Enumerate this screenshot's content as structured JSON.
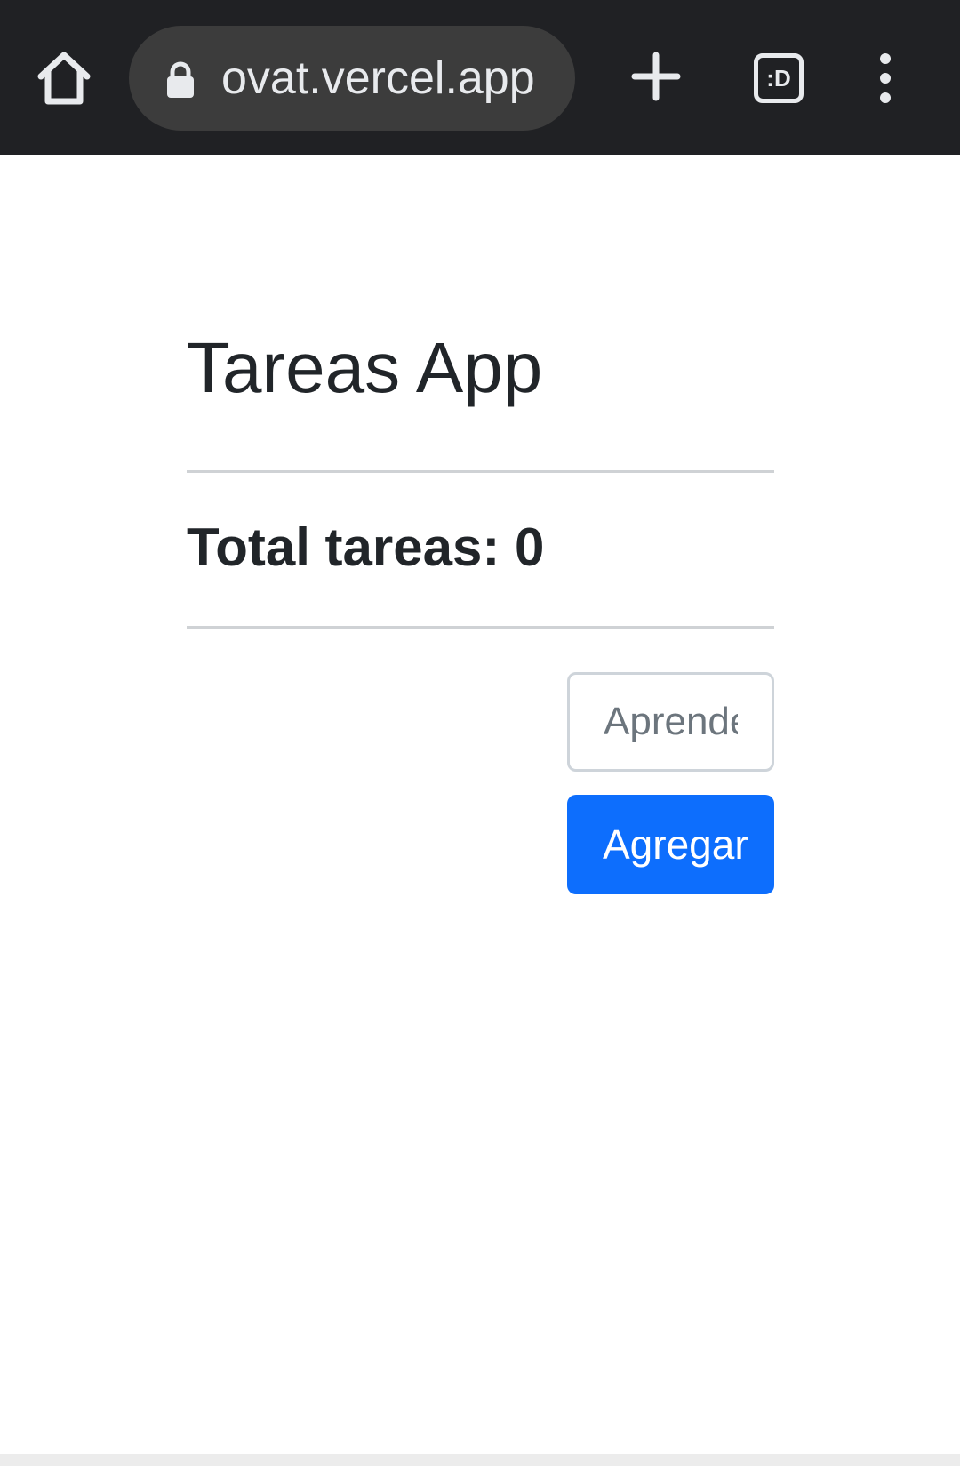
{
  "browser": {
    "url": "ovat.vercel.app",
    "tab_switcher_label": ":D"
  },
  "app": {
    "title": "Tareas App",
    "total_label": "Total tareas: 0",
    "input_placeholder": "Aprender",
    "add_button_label": "Agregar"
  },
  "colors": {
    "browser_bar": "#202124",
    "primary_button": "#0d6efd",
    "text": "#212529"
  },
  "icons": [
    "home-icon",
    "lock-icon",
    "plus-icon",
    "tab-switcher-icon",
    "more-vert-icon"
  ]
}
